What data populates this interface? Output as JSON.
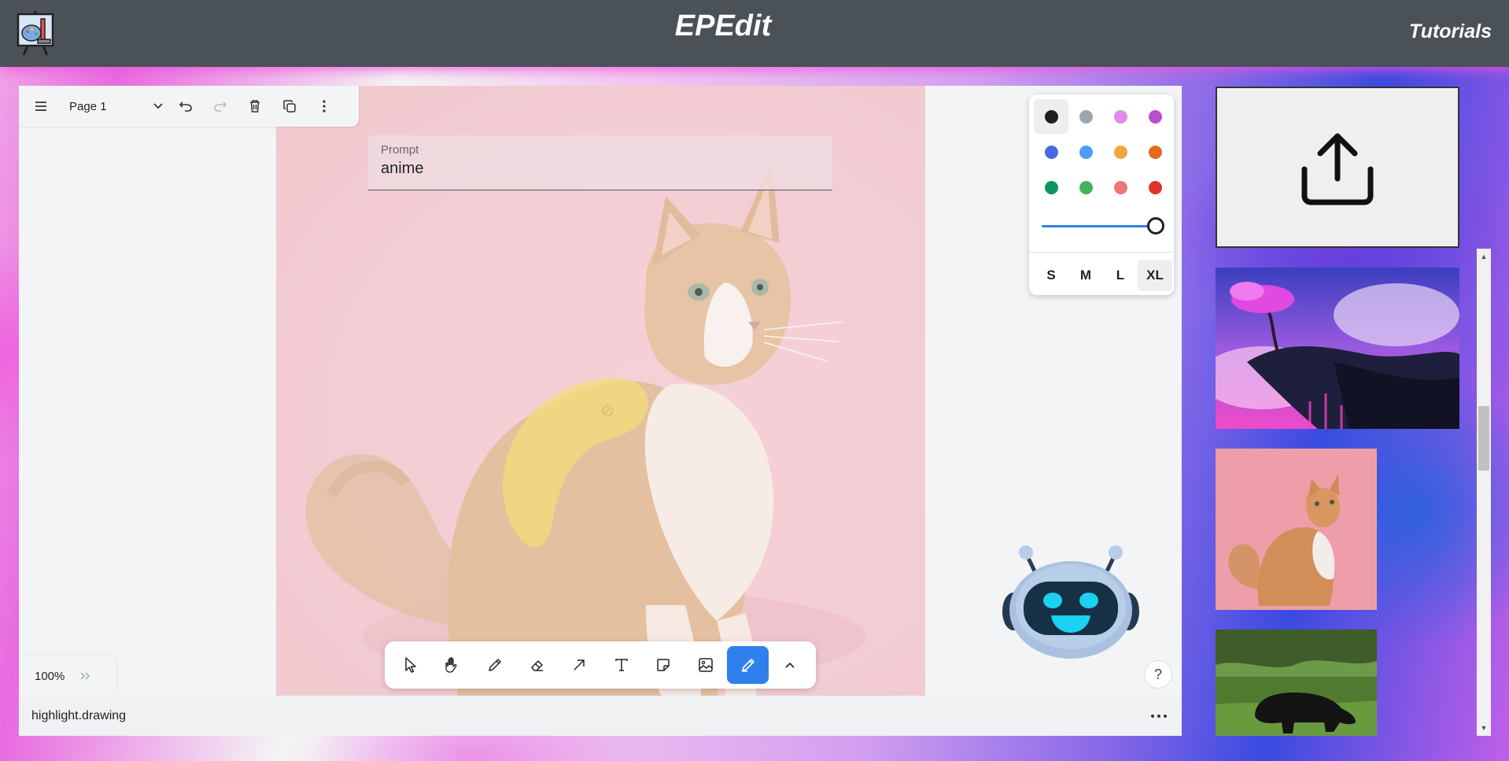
{
  "app": {
    "title": "EPEdit",
    "tutorials_label": "Tutorials"
  },
  "toolbar": {
    "page_label": "Page 1"
  },
  "prompt": {
    "label": "Prompt",
    "value": "anime"
  },
  "style_panel": {
    "colors": [
      "#1e1e1e",
      "#9ea5ad",
      "#e08be8",
      "#b84fd0",
      "#4b6ae0",
      "#4a9ef5",
      "#f0a73e",
      "#e46a1d",
      "#0f9560",
      "#42b35a",
      "#f0756f",
      "#e0312c"
    ],
    "selected_color": "#1e1e1e",
    "opacity": 1.0,
    "sizes": [
      "S",
      "M",
      "L",
      "XL"
    ],
    "selected_size": "XL"
  },
  "bottom_tools": [
    "select-tool",
    "hand-tool",
    "draw-tool",
    "eraser-tool",
    "arrow-tool",
    "text-tool",
    "note-tool",
    "image-tool",
    "highlight-tool",
    "more-tools"
  ],
  "active_tool": "highlight-tool",
  "zoom": {
    "value": "100%"
  },
  "help": {
    "label": "?"
  },
  "status": {
    "text": "highlight.drawing"
  },
  "colors": {
    "accent": "#2f80ed",
    "highlight": "#f0d04a",
    "topbar": "#4a5157"
  },
  "gallery": {
    "items": [
      "fantasy-landscape-thumbnail",
      "cat-thumbnail",
      "bear-thumbnail"
    ]
  }
}
